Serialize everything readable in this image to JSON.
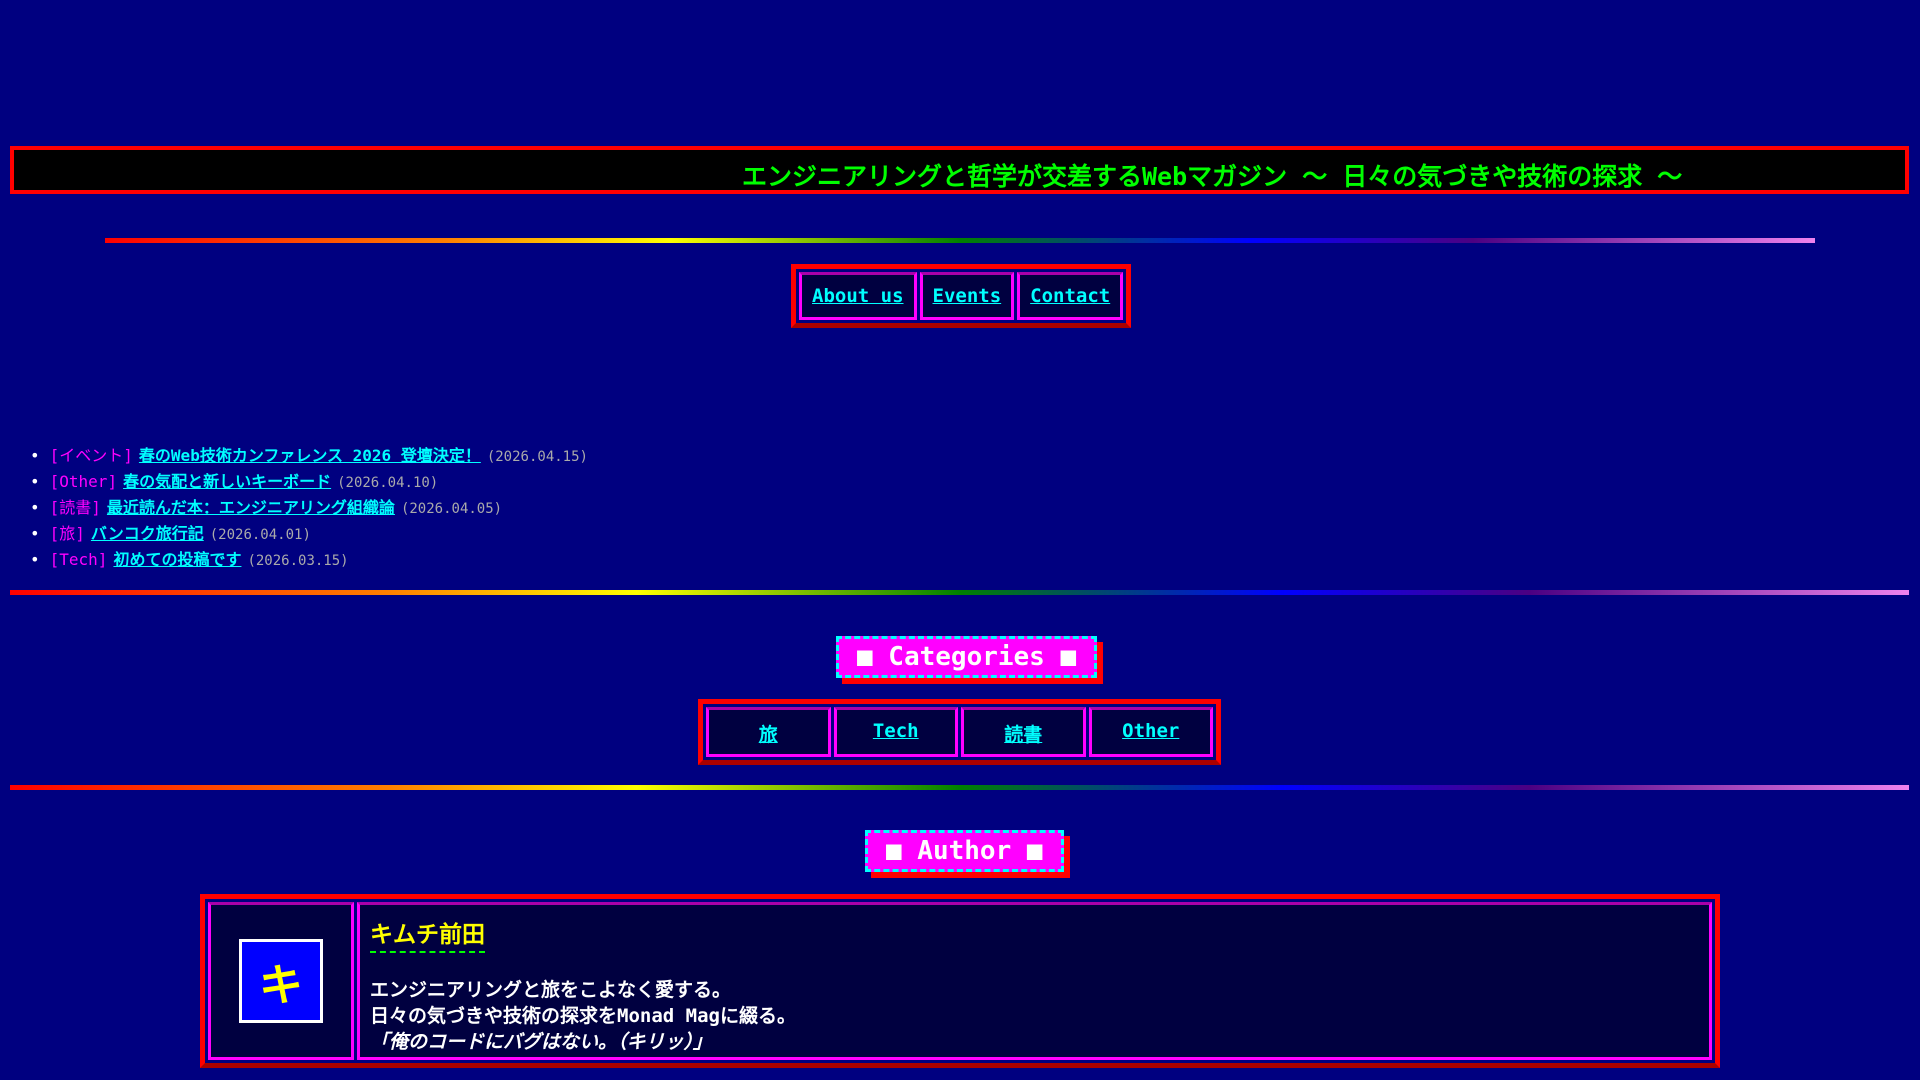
{
  "header": {
    "tagline": "エンジニアリングと哲学が交差するWebマガジン 〜 日々の気づきや技術の探求 〜"
  },
  "nav": {
    "items": [
      {
        "label": "About us"
      },
      {
        "label": "Events"
      },
      {
        "label": "Contact"
      }
    ]
  },
  "news": [
    {
      "tag": "[イベント]",
      "title": "春のWeb技術カンファレンス 2026 登壇決定！",
      "date": "(2026.04.15)"
    },
    {
      "tag": "[Other]",
      "title": "春の気配と新しいキーボード",
      "date": "(2026.04.10)"
    },
    {
      "tag": "[読書]",
      "title": "最近読んだ本：エンジニアリング組織論",
      "date": "(2026.04.05)"
    },
    {
      "tag": "[旅]",
      "title": "バンコク旅行記",
      "date": "(2026.04.01)"
    },
    {
      "tag": "[Tech]",
      "title": "初めての投稿です",
      "date": "(2026.03.15)"
    }
  ],
  "categories": {
    "heading": "■ Categories ■",
    "items": [
      {
        "label": "旅"
      },
      {
        "label": "Tech"
      },
      {
        "label": "読書"
      },
      {
        "label": "Other"
      }
    ]
  },
  "author": {
    "heading": "■ Author ■",
    "avatar_letter": "キ",
    "name": "キムチ前田",
    "bio": [
      "エンジニアリングと旅をこよなく愛する。",
      "日々の気づきや技術の探求をMonad Magに綴る。",
      "「俺のコードにバグはない。（キリッ）」"
    ]
  },
  "colors": {
    "background": "#000080",
    "accent": "#ff00ff",
    "link": "#00ffff",
    "border": "#ff0000"
  }
}
